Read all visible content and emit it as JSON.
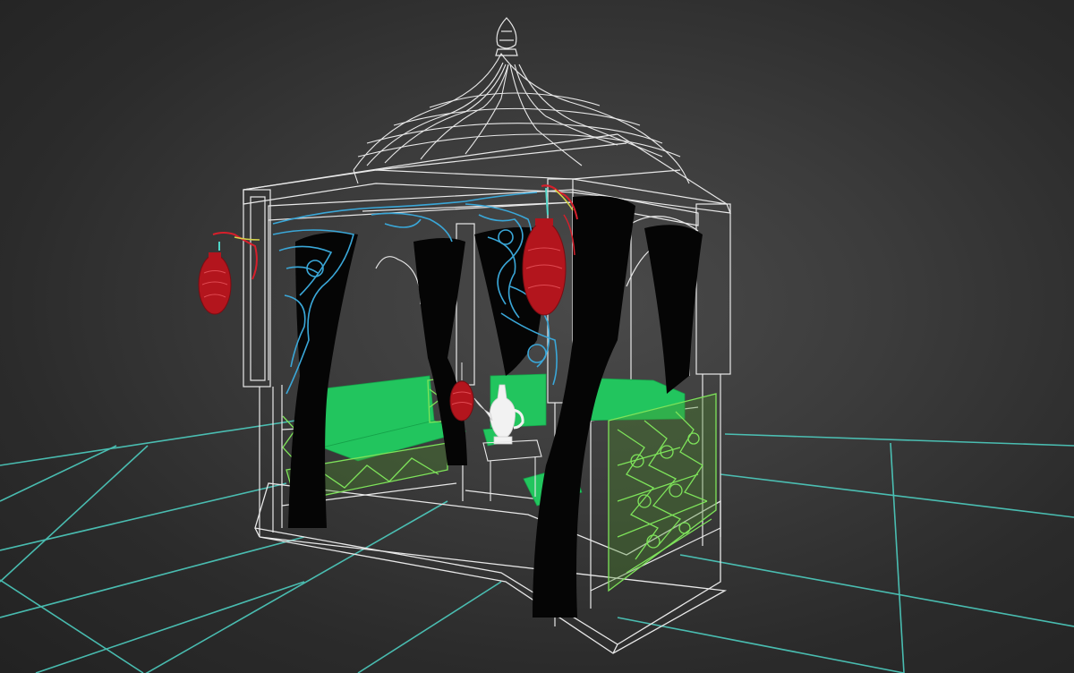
{
  "viewport": {
    "background": "#3a3a3a",
    "grid_color": "#4fd6c8",
    "wire_color": "#e8e8e8",
    "curtain_color": "#050505",
    "cushion_color": "#22c55e",
    "screen_color": "#7ee35a",
    "ornament_color": "#3aa7d8",
    "lantern_color": "#b3151d",
    "teapot_color": "#f2f2f2"
  },
  "scene": {
    "objects": [
      "gazebo-wireframe",
      "dome-roof",
      "finial",
      "curtain",
      "sofa",
      "lattice-screen",
      "lantern",
      "teapot"
    ]
  }
}
